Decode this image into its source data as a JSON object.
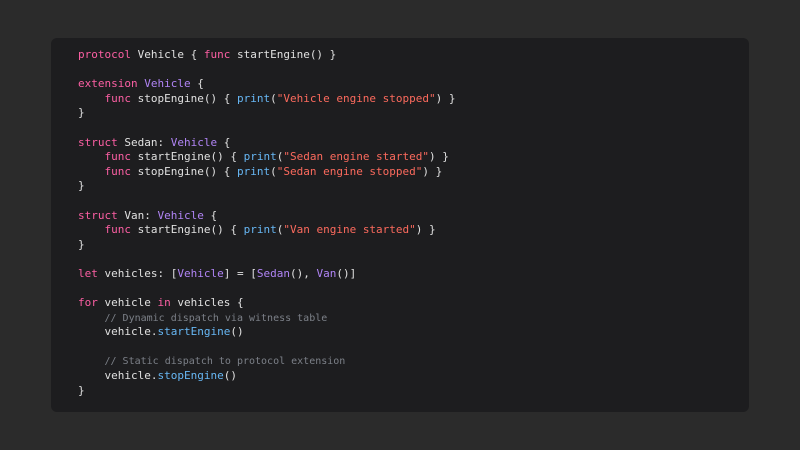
{
  "colors": {
    "page_background": "#2b2b2b",
    "panel_background": "#1d1d1f",
    "plain": "#e0e0e0",
    "keyword": "#fc5fa3",
    "type": "#b084f5",
    "string": "#fc6a5d",
    "call": "#67b7f4",
    "comment": "#7c8088"
  },
  "code": {
    "language": "swift",
    "lines": [
      [
        [
          "keyword",
          "protocol"
        ],
        [
          "plain",
          " Vehicle { "
        ],
        [
          "keyword",
          "func"
        ],
        [
          "plain",
          " startEngine() }"
        ]
      ],
      [],
      [
        [
          "keyword",
          "extension"
        ],
        [
          "plain",
          " "
        ],
        [
          "type",
          "Vehicle"
        ],
        [
          "plain",
          " {"
        ]
      ],
      [
        [
          "plain",
          "    "
        ],
        [
          "keyword",
          "func"
        ],
        [
          "plain",
          " stopEngine() { "
        ],
        [
          "call",
          "print"
        ],
        [
          "plain",
          "("
        ],
        [
          "string",
          "\"Vehicle engine stopped\""
        ],
        [
          "plain",
          ") }"
        ]
      ],
      [
        [
          "plain",
          "}"
        ]
      ],
      [],
      [
        [
          "keyword",
          "struct"
        ],
        [
          "plain",
          " Sedan: "
        ],
        [
          "type",
          "Vehicle"
        ],
        [
          "plain",
          " {"
        ]
      ],
      [
        [
          "plain",
          "    "
        ],
        [
          "keyword",
          "func"
        ],
        [
          "plain",
          " startEngine() { "
        ],
        [
          "call",
          "print"
        ],
        [
          "plain",
          "("
        ],
        [
          "string",
          "\"Sedan engine started\""
        ],
        [
          "plain",
          ") }"
        ]
      ],
      [
        [
          "plain",
          "    "
        ],
        [
          "keyword",
          "func"
        ],
        [
          "plain",
          " stopEngine() { "
        ],
        [
          "call",
          "print"
        ],
        [
          "plain",
          "("
        ],
        [
          "string",
          "\"Sedan engine stopped\""
        ],
        [
          "plain",
          ") }"
        ]
      ],
      [
        [
          "plain",
          "}"
        ]
      ],
      [],
      [
        [
          "keyword",
          "struct"
        ],
        [
          "plain",
          " Van: "
        ],
        [
          "type",
          "Vehicle"
        ],
        [
          "plain",
          " {"
        ]
      ],
      [
        [
          "plain",
          "    "
        ],
        [
          "keyword",
          "func"
        ],
        [
          "plain",
          " startEngine() { "
        ],
        [
          "call",
          "print"
        ],
        [
          "plain",
          "("
        ],
        [
          "string",
          "\"Van engine started\""
        ],
        [
          "plain",
          ") }"
        ]
      ],
      [
        [
          "plain",
          "}"
        ]
      ],
      [],
      [
        [
          "keyword",
          "let"
        ],
        [
          "plain",
          " vehicles: ["
        ],
        [
          "type",
          "Vehicle"
        ],
        [
          "plain",
          "] = ["
        ],
        [
          "type",
          "Sedan"
        ],
        [
          "plain",
          "(), "
        ],
        [
          "type",
          "Van"
        ],
        [
          "plain",
          "()]"
        ]
      ],
      [],
      [
        [
          "keyword",
          "for"
        ],
        [
          "plain",
          " vehicle "
        ],
        [
          "keyword",
          "in"
        ],
        [
          "plain",
          " vehicles {"
        ]
      ],
      [
        [
          "plain",
          "    "
        ],
        [
          "comment",
          "// Dynamic dispatch via witness table"
        ]
      ],
      [
        [
          "plain",
          "    vehicle."
        ],
        [
          "call",
          "startEngine"
        ],
        [
          "plain",
          "()"
        ]
      ],
      [],
      [
        [
          "plain",
          "    "
        ],
        [
          "comment",
          "// Static dispatch to protocol extension"
        ]
      ],
      [
        [
          "plain",
          "    vehicle."
        ],
        [
          "call",
          "stopEngine"
        ],
        [
          "plain",
          "()"
        ]
      ],
      [
        [
          "plain",
          "}"
        ]
      ]
    ]
  }
}
